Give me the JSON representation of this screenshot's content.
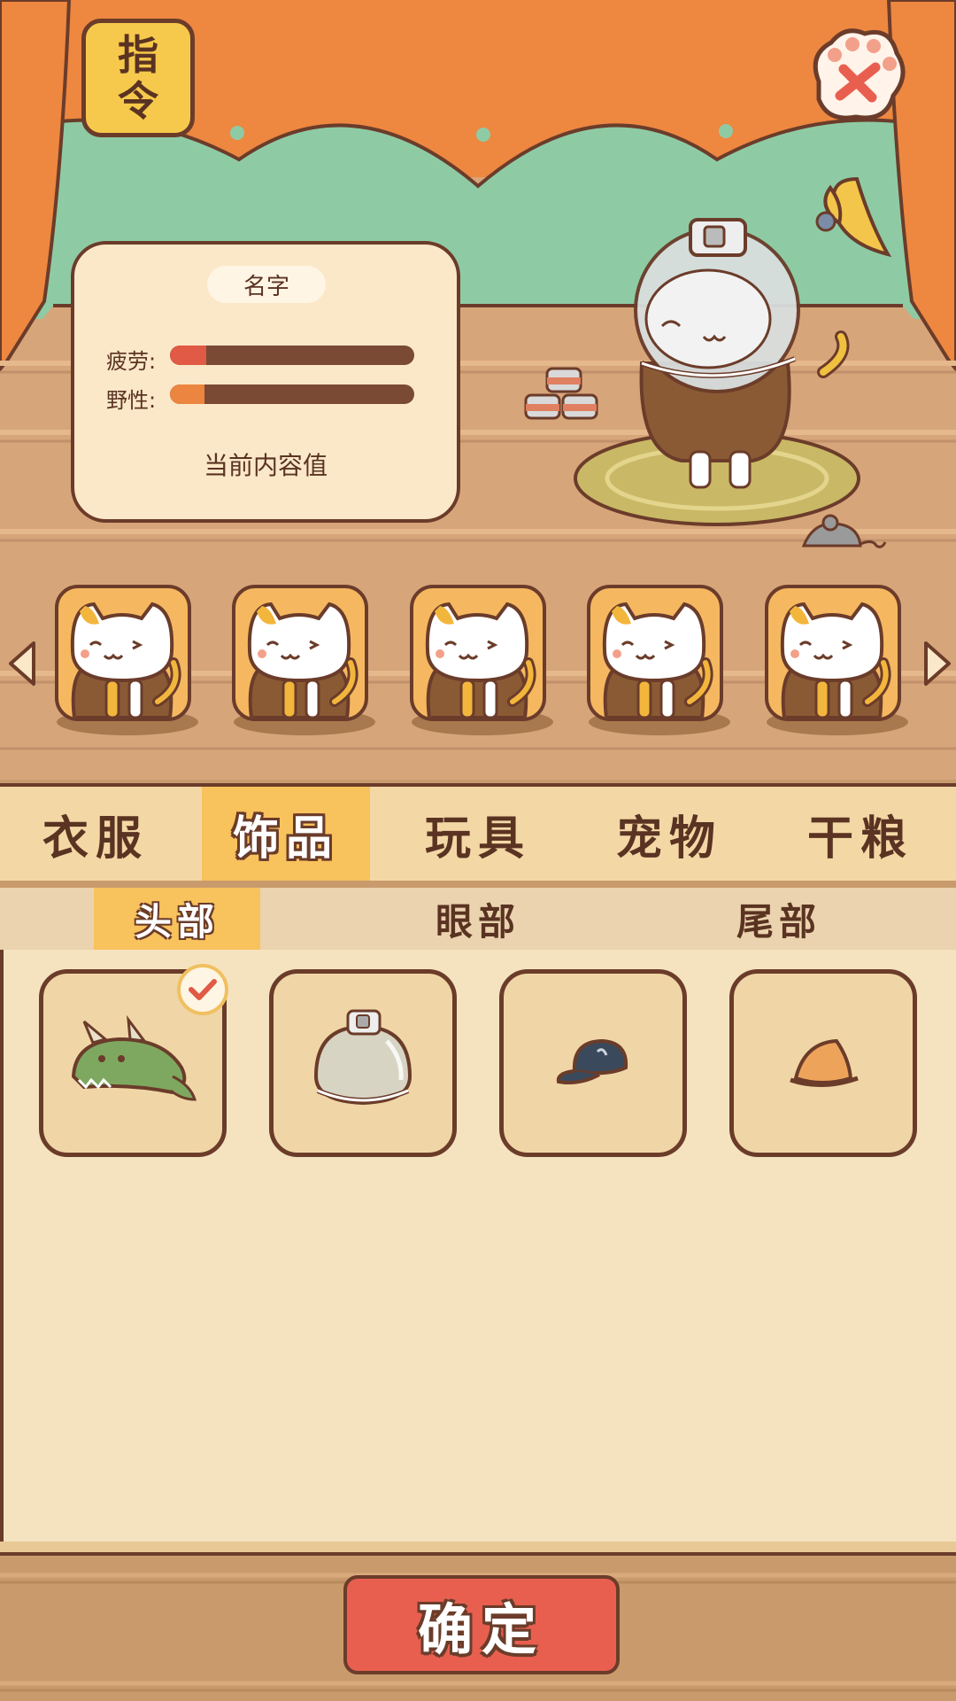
{
  "buttons": {
    "command_label": "指令",
    "confirm_label": "确定",
    "close_icon": "paw-close-icon"
  },
  "stats": {
    "name": "名字",
    "fatigue_label": "疲劳:",
    "fatigue_value": 0.15,
    "fatigue_color": "#e05a45",
    "wildness_label": "野性:",
    "wildness_value": 0.14,
    "wildness_color": "#ec8540",
    "content_label": "当前内容值"
  },
  "roster": {
    "cats": [
      "cat-1",
      "cat-2",
      "cat-3",
      "cat-4",
      "cat-5"
    ],
    "prev_icon": "triangle-left-icon",
    "next_icon": "triangle-right-icon"
  },
  "tabs": {
    "items": [
      "衣服",
      "饰品",
      "玩具",
      "宠物",
      "干粮"
    ],
    "active": "饰品"
  },
  "subtabs": {
    "items": [
      "头部",
      "眼部",
      "尾部"
    ],
    "active": "头部"
  },
  "items": [
    {
      "name": "dinosaur-hat",
      "selected": true
    },
    {
      "name": "astronaut-helmet",
      "selected": false
    },
    {
      "name": "navy-cap",
      "selected": false
    },
    {
      "name": "orange-hat",
      "selected": false
    }
  ],
  "colors": {
    "curtain": "#ee8740",
    "hills": "#8ecba5",
    "accent": "#f8c25c",
    "outline": "#6b3c2a",
    "confirm": "#e85f50"
  }
}
